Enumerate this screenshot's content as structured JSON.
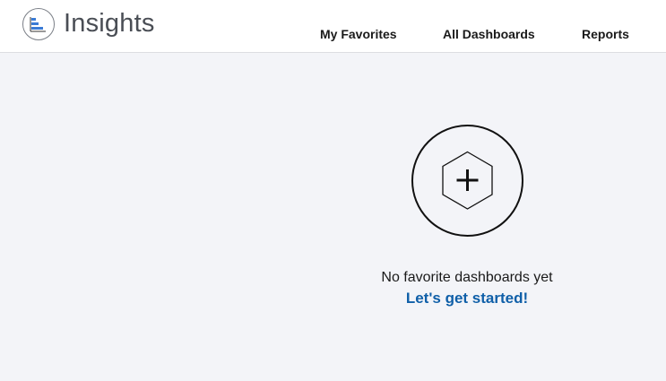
{
  "header": {
    "app_title": "Insights",
    "logo_icon": "insights-bars-icon",
    "nav": {
      "my_favorites": "My Favorites",
      "all_dashboards": "All Dashboards",
      "reports": "Reports"
    }
  },
  "empty_state": {
    "icon": "hexagon-plus-icon",
    "message": "No favorite dashboards yet",
    "cta": "Let's get started!"
  },
  "colors": {
    "background": "#f3f4f8",
    "header_background": "#ffffff",
    "accent_link": "#0f5fa8",
    "logo_blue": "#3a7bd5"
  }
}
